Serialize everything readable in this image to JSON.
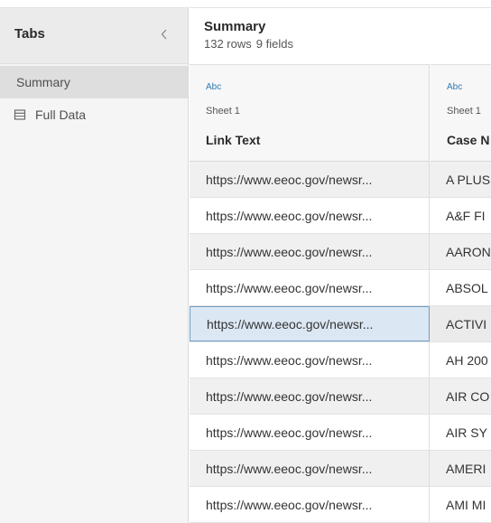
{
  "tabs_panel": {
    "title": "Tabs",
    "collapse_glyph": "‹",
    "items": [
      {
        "label": "Summary",
        "icon": null
      },
      {
        "label": "Full Data",
        "icon": "table-icon"
      }
    ]
  },
  "summary": {
    "title": "Summary",
    "rows_text": "132 rows",
    "fields_text": "9 fields"
  },
  "columns": [
    {
      "type_label": "Abc",
      "sheet": "Sheet 1",
      "name": "Link Text"
    },
    {
      "type_label": "Abc",
      "sheet": "Sheet 1",
      "name": "Case N"
    }
  ],
  "rows": [
    {
      "link": "https://www.eeoc.gov/newsr...",
      "case": "A PLUS"
    },
    {
      "link": "https://www.eeoc.gov/newsr...",
      "case": "A&F FI"
    },
    {
      "link": "https://www.eeoc.gov/newsr...",
      "case": "AARON"
    },
    {
      "link": "https://www.eeoc.gov/newsr...",
      "case": "ABSOL"
    },
    {
      "link": "https://www.eeoc.gov/newsr...",
      "case": "ACTIVI"
    },
    {
      "link": "https://www.eeoc.gov/newsr...",
      "case": "AH 200"
    },
    {
      "link": "https://www.eeoc.gov/newsr...",
      "case": "AIR CO"
    },
    {
      "link": "https://www.eeoc.gov/newsr...",
      "case": "AIR SY"
    },
    {
      "link": "https://www.eeoc.gov/newsr...",
      "case": "AMERI"
    },
    {
      "link": "https://www.eeoc.gov/newsr...",
      "case": "AMI MI"
    }
  ],
  "selected_row_index": 4,
  "colors": {
    "type_accent": "#2f7bb4",
    "selection_border": "#6f9ec4",
    "selection_fill": "#dbe7f3"
  }
}
